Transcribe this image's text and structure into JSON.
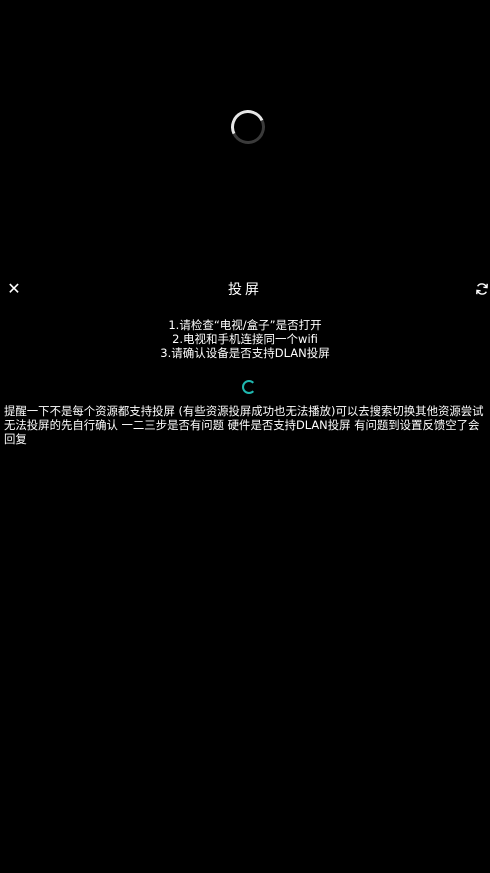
{
  "player": {
    "loading_icon": "loading-spinner-icon"
  },
  "header": {
    "close_icon": "close-icon",
    "close_glyph": "✕",
    "title": "投屏",
    "refresh_icon": "refresh-icon"
  },
  "instructions": [
    "1.请检查“电视/盒子”是否打开",
    "2.电视和手机连接同一个wifi",
    "3.请确认设备是否支持DLAN投屏"
  ],
  "search_loading_icon": "device-search-spinner-icon",
  "tip": "提醒一下不是每个资源都支持投屏 (有些资源投屏成功也无法播放)可以去搜索切换其他资源尝试  无法投屏的先自行确认 一二三步是否有问题  硬件是否支持DLAN投屏 有问题到设置反馈空了会回复",
  "colors": {
    "background": "#000000",
    "text": "#ffffff",
    "accent_spinner": "#1fb8b0"
  }
}
